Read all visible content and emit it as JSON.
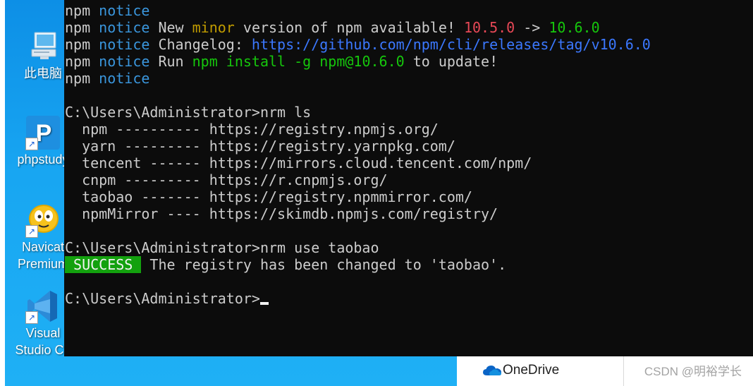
{
  "desktop": {
    "icons": [
      {
        "name": "this-pc",
        "lines": [
          "此电脑"
        ]
      },
      {
        "name": "phpstudy",
        "lines": [
          "phpstudy"
        ]
      },
      {
        "name": "navicat",
        "lines": [
          "Navicat",
          "Premium"
        ]
      },
      {
        "name": "vscode",
        "lines": [
          "Visual",
          "Studio Co"
        ]
      }
    ]
  },
  "terminal": {
    "lines": [
      [
        {
          "t": "npm ",
          "c": "default"
        },
        {
          "t": "notice",
          "c": "cyan"
        }
      ],
      [
        {
          "t": "npm ",
          "c": "default"
        },
        {
          "t": "notice",
          "c": "cyan"
        },
        {
          "t": " New ",
          "c": "default"
        },
        {
          "t": "minor",
          "c": "yellow"
        },
        {
          "t": " version of npm available! ",
          "c": "default"
        },
        {
          "t": "10.5.0",
          "c": "red"
        },
        {
          "t": " -> ",
          "c": "default"
        },
        {
          "t": "10.6.0",
          "c": "green"
        }
      ],
      [
        {
          "t": "npm ",
          "c": "default"
        },
        {
          "t": "notice",
          "c": "cyan"
        },
        {
          "t": " Changelog: ",
          "c": "default"
        },
        {
          "t": "https://github.com/npm/cli/releases/tag/v10.6.0",
          "c": "blue"
        }
      ],
      [
        {
          "t": "npm ",
          "c": "default"
        },
        {
          "t": "notice",
          "c": "cyan"
        },
        {
          "t": " Run ",
          "c": "default"
        },
        {
          "t": "npm install -g npm@10.6.0",
          "c": "green"
        },
        {
          "t": " to update!",
          "c": "default"
        }
      ],
      [
        {
          "t": "npm ",
          "c": "default"
        },
        {
          "t": "notice",
          "c": "cyan"
        }
      ],
      [],
      [
        {
          "t": "C:\\Users\\Administrator>nrm ls",
          "c": "default"
        }
      ],
      [
        {
          "t": "  npm ---------- https://registry.npmjs.org/",
          "c": "default"
        }
      ],
      [
        {
          "t": "  yarn --------- https://registry.yarnpkg.com/",
          "c": "default"
        }
      ],
      [
        {
          "t": "  tencent ------ https://mirrors.cloud.tencent.com/npm/",
          "c": "default"
        }
      ],
      [
        {
          "t": "  cnpm --------- https://r.cnpmjs.org/",
          "c": "default"
        }
      ],
      [
        {
          "t": "  taobao ------- https://registry.npmmirror.com/",
          "c": "default"
        }
      ],
      [
        {
          "t": "  npmMirror ---- https://skimdb.npmjs.com/registry/",
          "c": "default"
        }
      ],
      [],
      [
        {
          "t": "C:\\Users\\Administrator>nrm use taobao",
          "c": "default"
        }
      ],
      [
        {
          "t": " SUCCESS ",
          "c": "success"
        },
        {
          "t": " The registry has been changed to 'taobao'.",
          "c": "default"
        }
      ],
      [],
      [
        {
          "t": "C:\\Users\\Administrator>",
          "c": "default",
          "cursor": true
        }
      ]
    ]
  },
  "taskbar": {
    "onedrive_label": "OneDrive",
    "watermark": "CSDN @明裕学长"
  },
  "colors": {
    "terminal_bg": "#0c0c0c",
    "terminal_text": "#cccccc",
    "notice_cyan": "#3a96dd",
    "minor_yellow": "#c19c00",
    "old_version_red": "#e74856",
    "new_version_green": "#16c60c",
    "link_blue": "#3b78ff",
    "success_badge": "#13a10e",
    "desktop_blue": "#1aa3f0"
  }
}
